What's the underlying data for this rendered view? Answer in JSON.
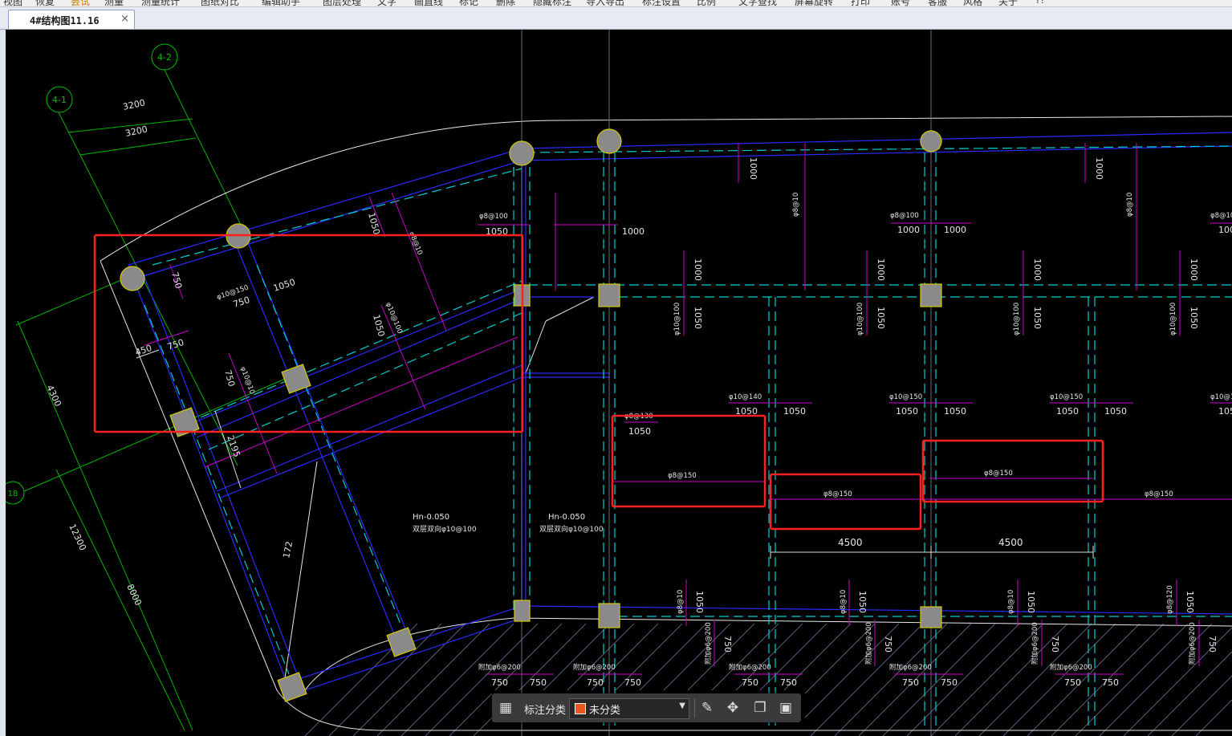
{
  "menu": {
    "items": [
      "视图",
      "恢复",
      "尝试",
      "测量",
      "测量统计",
      "图纸对比",
      "编辑助手",
      "图层处理",
      "文字",
      "画直线",
      "标记",
      "删除",
      "隐藏标注",
      "导入导出",
      "标注设置",
      "比例",
      "文字查找",
      "屏幕旋转",
      "打印",
      "账号",
      "客服",
      "风格",
      "关于",
      "?!"
    ]
  },
  "tab": {
    "title": "4#结构图11.16",
    "close": "×"
  },
  "drawing": {
    "axes": {
      "a1": "4-1",
      "a2": "4-2",
      "a3": "18"
    },
    "dims": {
      "d3200": "3200",
      "d4300": "4300",
      "d12300": "12300",
      "d8000": "8000",
      "d750": "750",
      "d450": "450",
      "d1050": "1050",
      "d1000": "1000",
      "d2195": "2195",
      "d4500": "4500",
      "d172": "172"
    },
    "notes": {
      "n8_100": "φ8@100",
      "n8_10": "φ8@10",
      "n10_150": "φ10@150",
      "n10_140": "φ10@140",
      "n8_130": "φ8@130",
      "n8_150": "φ8@150",
      "n10_10": "φ10@10",
      "n10_100": "φ10@100",
      "n8_120": "φ8@120",
      "n6_200": "附加φ6@200",
      "hn1": "Hn-0.050",
      "hn_r1": "双层双向φ10@100",
      "hn2": "Hn-0.050",
      "hn_r2": "双层双向φ10@100"
    }
  },
  "toolbar": {
    "grid_icon": "grid-icon",
    "label": "标注分类",
    "category_value": "未分类",
    "category_color": "#e8581d",
    "icons": [
      "edit-icon",
      "move-icon",
      "copy-icon",
      "paste-icon"
    ]
  },
  "colors": {
    "highlight": "#ff2020",
    "beam": "#2222ff",
    "axis": "#00cc00",
    "dim": "#cc00cc",
    "dash": "#00cccc"
  }
}
